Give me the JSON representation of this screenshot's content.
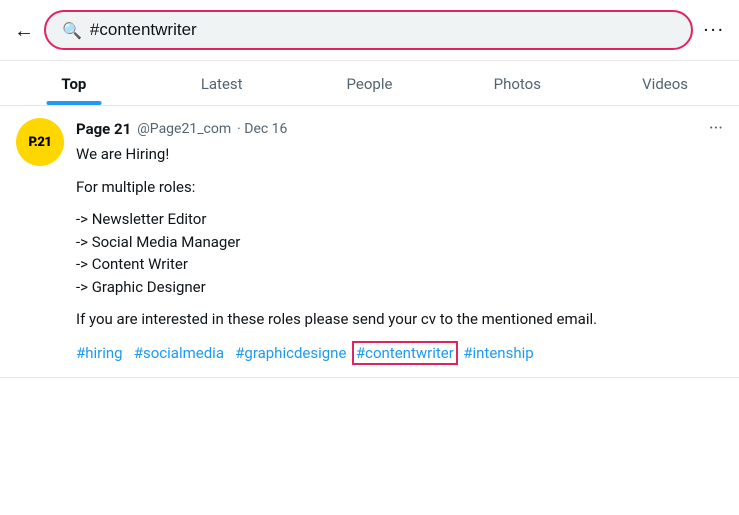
{
  "header": {
    "search_query": "#contentwriter",
    "more_icon": "···"
  },
  "tabs": [
    {
      "id": "top",
      "label": "Top",
      "active": true
    },
    {
      "id": "latest",
      "label": "Latest",
      "active": false
    },
    {
      "id": "people",
      "label": "People",
      "active": false
    },
    {
      "id": "photos",
      "label": "Photos",
      "active": false
    },
    {
      "id": "videos",
      "label": "Videos",
      "active": false
    }
  ],
  "tweet": {
    "author_name": "Page 21",
    "author_handle": "@Page21_com",
    "date": "Dec 16",
    "avatar_text": "P.21",
    "line1": "We are Hiring!",
    "line2": "For multiple roles:",
    "roles": [
      "-> Newsletter Editor",
      "-> Social Media Manager",
      "-> Content Writer",
      "-> Graphic Designer"
    ],
    "closing_text": "If you are interested in these roles please send your cv to the mentioned email.",
    "hashtags": [
      {
        "text": "#hiring",
        "highlighted": false
      },
      {
        "text": "#socialmedia",
        "highlighted": false
      },
      {
        "text": "#graphicdesigne",
        "highlighted": false
      },
      {
        "text": "#contentwriter",
        "highlighted": true
      },
      {
        "text": "#intenship",
        "highlighted": false
      }
    ]
  }
}
